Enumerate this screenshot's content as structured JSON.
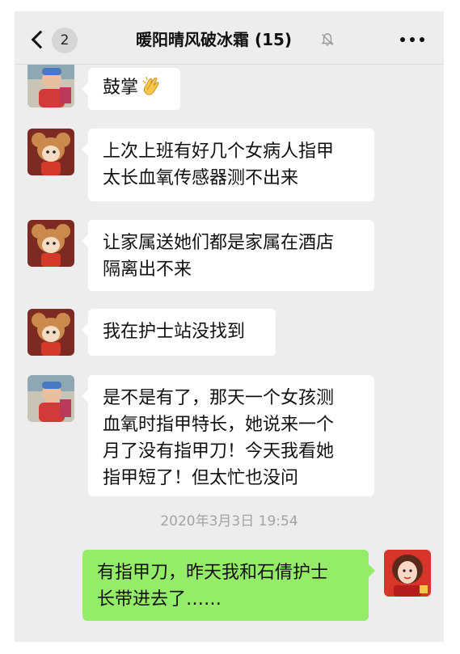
{
  "header": {
    "back_count": "2",
    "title": "暖阳晴风破冰霜 (15)"
  },
  "messages": [
    {
      "sender": "friend-a",
      "text": "鼓掌",
      "emoji": "clapping-hands"
    },
    {
      "sender": "friend-b",
      "lines": [
        "上次上班有好几个女病人指甲",
        "太长血氧传感器测不出来"
      ]
    },
    {
      "sender": "friend-b",
      "lines": [
        "让家属送她们都是家属在酒店",
        "隔离出不来"
      ]
    },
    {
      "sender": "friend-b",
      "lines": [
        "我在护士站没找到"
      ]
    },
    {
      "sender": "friend-a",
      "lines": [
        "是不是有了，那天一个女孩测",
        "血氧时指甲特长，她说来一个",
        "月了没有指甲刀！今天我看她",
        "指甲短了！但太忙也没问"
      ]
    }
  ],
  "timestamp": "2020年3月3日 19:54",
  "my_message": {
    "lines": [
      "有指甲刀，昨天我和石倩护士",
      "长带进去了……"
    ]
  },
  "colors": {
    "background": "#ededed",
    "my_bubble": "#95ec69",
    "friend_bubble": "#ffffff",
    "timestamp": "#a3a3a3"
  }
}
